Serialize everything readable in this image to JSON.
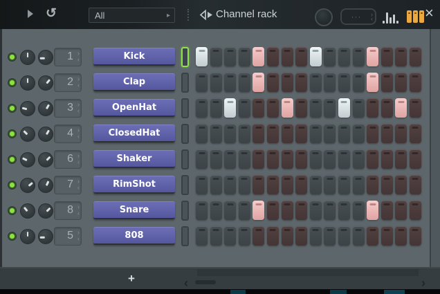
{
  "toolbar": {
    "undo_icon": "↺",
    "filter_selector": {
      "value": "All",
      "arrow": "▸"
    },
    "title": "Channel rack",
    "preset_box": {
      "dots": "···",
      "chev_up": "›",
      "chev_down": "‹"
    },
    "close_icon": "×"
  },
  "channels": [
    {
      "number": "1",
      "name": "Kick",
      "selected": true,
      "pan_angle": 0,
      "vol_angle": 270,
      "steps": [
        1,
        0,
        0,
        0,
        1,
        0,
        0,
        0,
        1,
        0,
        0,
        0,
        1,
        0,
        0,
        0
      ]
    },
    {
      "number": "2",
      "name": "Clap",
      "selected": false,
      "pan_angle": 0,
      "vol_angle": 40,
      "steps": [
        0,
        0,
        0,
        0,
        1,
        0,
        0,
        0,
        0,
        0,
        0,
        0,
        1,
        0,
        0,
        0
      ]
    },
    {
      "number": "3",
      "name": "OpenHat",
      "selected": false,
      "pan_angle": 285,
      "vol_angle": 30,
      "steps": [
        0,
        0,
        1,
        0,
        0,
        0,
        1,
        0,
        0,
        0,
        1,
        0,
        0,
        0,
        1,
        0
      ]
    },
    {
      "number": "4",
      "name": "ClosedHat",
      "selected": false,
      "pan_angle": 315,
      "vol_angle": 30,
      "steps": [
        0,
        0,
        0,
        0,
        0,
        0,
        0,
        0,
        0,
        0,
        0,
        0,
        0,
        0,
        0,
        0
      ]
    },
    {
      "number": "6",
      "name": "Shaker",
      "selected": false,
      "pan_angle": 295,
      "vol_angle": 45,
      "steps": [
        0,
        0,
        0,
        0,
        0,
        0,
        0,
        0,
        0,
        0,
        0,
        0,
        0,
        0,
        0,
        0
      ]
    },
    {
      "number": "7",
      "name": "RimShot",
      "selected": false,
      "pan_angle": 50,
      "vol_angle": 25,
      "steps": [
        0,
        0,
        0,
        0,
        0,
        0,
        0,
        0,
        0,
        0,
        0,
        0,
        0,
        0,
        0,
        0
      ]
    },
    {
      "number": "8",
      "name": "Snare",
      "selected": false,
      "pan_angle": 320,
      "vol_angle": 45,
      "steps": [
        0,
        0,
        0,
        0,
        1,
        0,
        0,
        0,
        0,
        0,
        0,
        0,
        1,
        0,
        0,
        0
      ]
    },
    {
      "number": "5",
      "name": "808",
      "selected": false,
      "pan_angle": 0,
      "vol_angle": 270,
      "steps": [
        0,
        0,
        0,
        0,
        0,
        0,
        0,
        0,
        0,
        0,
        0,
        0,
        0,
        0,
        0,
        0
      ]
    }
  ],
  "step_spinner": {
    "up": "›",
    "down": "‹"
  },
  "bottom_bar": {
    "add_channel_label": "+",
    "scroll_left_arrow": "‹",
    "scroll_right_arrow": "›"
  },
  "colors": {
    "channel_button": "#5c5ea6",
    "step_lit_light": "#d3dee1",
    "step_lit_pink": "#e7b3b1",
    "step_unlit_gray": "#424a4d",
    "step_unlit_maroon": "#4a3b3c",
    "led_green": "#8be33e",
    "selected_pill_green": "#8fe24a",
    "icon_orange": "#eca83e",
    "panel_bg": "#5d666b",
    "titlebar_bg": "#1d2326",
    "behind_window_teal": "#0e4252"
  }
}
